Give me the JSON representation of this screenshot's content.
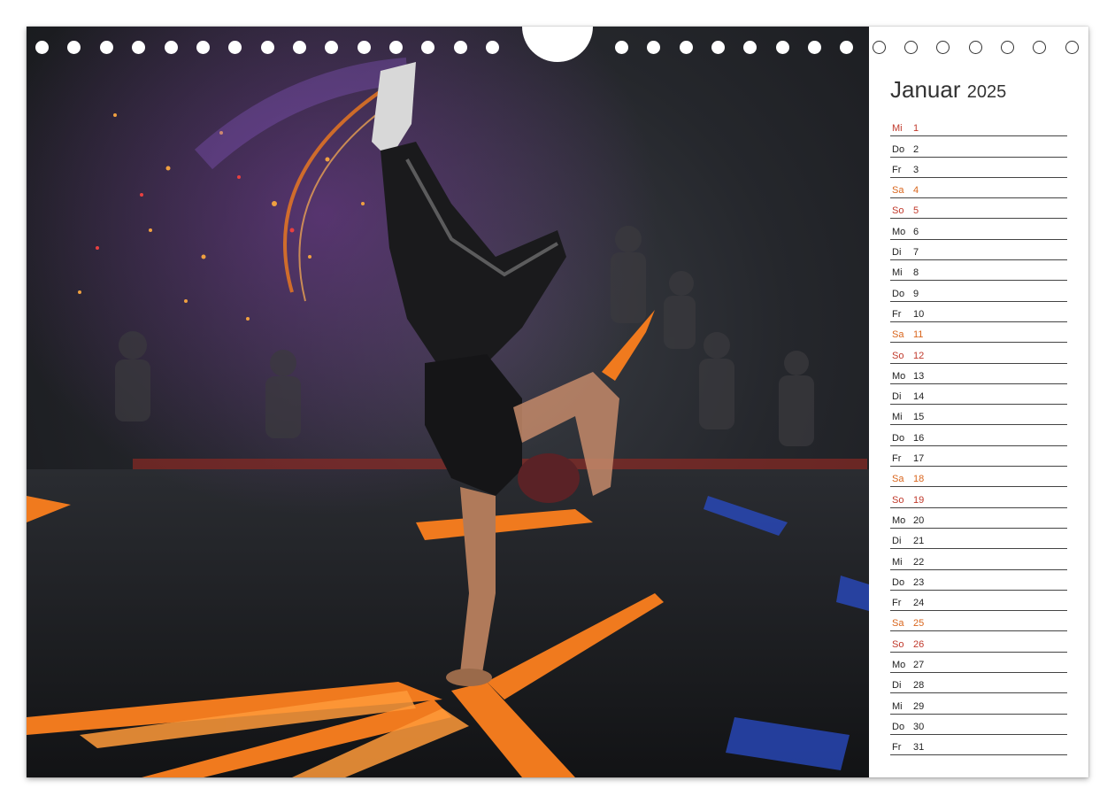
{
  "calendar": {
    "month": "Januar",
    "year": "2025",
    "days": [
      {
        "wd": "Mi",
        "d": "1",
        "type": "red"
      },
      {
        "wd": "Do",
        "d": "2",
        "type": "normal"
      },
      {
        "wd": "Fr",
        "d": "3",
        "type": "normal"
      },
      {
        "wd": "Sa",
        "d": "4",
        "type": "orange"
      },
      {
        "wd": "So",
        "d": "5",
        "type": "red"
      },
      {
        "wd": "Mo",
        "d": "6",
        "type": "normal"
      },
      {
        "wd": "Di",
        "d": "7",
        "type": "normal"
      },
      {
        "wd": "Mi",
        "d": "8",
        "type": "normal"
      },
      {
        "wd": "Do",
        "d": "9",
        "type": "normal"
      },
      {
        "wd": "Fr",
        "d": "10",
        "type": "normal"
      },
      {
        "wd": "Sa",
        "d": "11",
        "type": "orange"
      },
      {
        "wd": "So",
        "d": "12",
        "type": "red"
      },
      {
        "wd": "Mo",
        "d": "13",
        "type": "normal"
      },
      {
        "wd": "Di",
        "d": "14",
        "type": "normal"
      },
      {
        "wd": "Mi",
        "d": "15",
        "type": "normal"
      },
      {
        "wd": "Do",
        "d": "16",
        "type": "normal"
      },
      {
        "wd": "Fr",
        "d": "17",
        "type": "normal"
      },
      {
        "wd": "Sa",
        "d": "18",
        "type": "orange"
      },
      {
        "wd": "So",
        "d": "19",
        "type": "red"
      },
      {
        "wd": "Mo",
        "d": "20",
        "type": "normal"
      },
      {
        "wd": "Di",
        "d": "21",
        "type": "normal"
      },
      {
        "wd": "Mi",
        "d": "22",
        "type": "normal"
      },
      {
        "wd": "Do",
        "d": "23",
        "type": "normal"
      },
      {
        "wd": "Fr",
        "d": "24",
        "type": "normal"
      },
      {
        "wd": "Sa",
        "d": "25",
        "type": "orange"
      },
      {
        "wd": "So",
        "d": "26",
        "type": "red"
      },
      {
        "wd": "Mo",
        "d": "27",
        "type": "normal"
      },
      {
        "wd": "Di",
        "d": "28",
        "type": "normal"
      },
      {
        "wd": "Mi",
        "d": "29",
        "type": "normal"
      },
      {
        "wd": "Do",
        "d": "30",
        "type": "normal"
      },
      {
        "wd": "Fr",
        "d": "31",
        "type": "normal"
      }
    ]
  },
  "colors": {
    "holiday": "#c0392b",
    "saturday": "#d9651c",
    "accent_orange": "#f07a1e"
  },
  "photo": {
    "subject": "breakdancer-handstand-icon"
  }
}
